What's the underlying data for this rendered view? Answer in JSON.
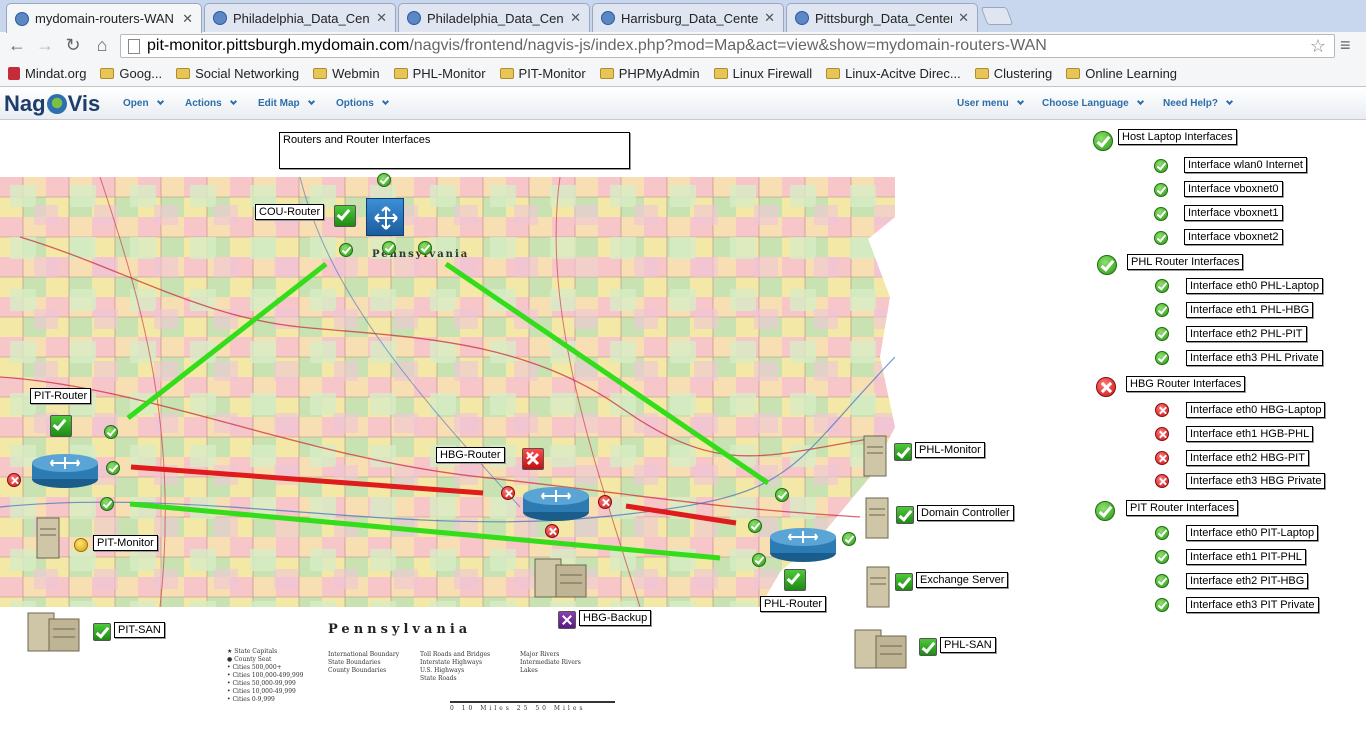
{
  "browser": {
    "tabs": [
      {
        "title": "mydomain-routers-WAN",
        "active": true
      },
      {
        "title": "Philadelphia_Data_Center",
        "active": false
      },
      {
        "title": "Philadelphia_Data_Center",
        "active": false
      },
      {
        "title": "Harrisburg_Data_Center (",
        "active": false
      },
      {
        "title": "Pittsburgh_Data_Center_",
        "active": false
      }
    ],
    "url_host": "pit-monitor.pittsburgh.mydomain.com",
    "url_path": "/nagvis/frontend/nagvis-js/index.php?mod=Map&act=view&show=mydomain-routers-WAN",
    "bookmarks": [
      {
        "label": "Mindat.org",
        "icon": "mindat-icon"
      },
      {
        "label": "Goog...",
        "icon": "folder-icon"
      },
      {
        "label": "Social Networking",
        "icon": "folder-icon"
      },
      {
        "label": "Webmin",
        "icon": "folder-icon"
      },
      {
        "label": "PHL-Monitor",
        "icon": "folder-icon"
      },
      {
        "label": "PIT-Monitor",
        "icon": "folder-icon"
      },
      {
        "label": "PHPMyAdmin",
        "icon": "folder-icon"
      },
      {
        "label": "Linux Firewall",
        "icon": "folder-icon"
      },
      {
        "label": "Linux-Acitve Direc...",
        "icon": "folder-icon"
      },
      {
        "label": "Clustering",
        "icon": "folder-icon"
      },
      {
        "label": "Online Learning",
        "icon": "folder-icon"
      }
    ]
  },
  "nagvis": {
    "logo_a": "Nag",
    "logo_b": "Vis",
    "menu_left": [
      "Open",
      "Actions",
      "Edit Map",
      "Options"
    ],
    "menu_right": [
      "User menu",
      "Choose Language",
      "Need Help?"
    ]
  },
  "map": {
    "title": "Routers and Router Interfaces",
    "state_label": "Pennsylvania",
    "map_caption": "Pennsylvania",
    "nodes": {
      "cou_router": "COU-Router",
      "pit_router": "PIT-Router",
      "hbg_router": "HBG-Router",
      "phl_router": "PHL-Router",
      "pit_monitor": "PIT-Monitor",
      "pit_san": "PIT-SAN",
      "hbg_backup": "HBG-Backup",
      "phl_monitor": "PHL-Monitor",
      "domain_controller": "Domain Controller",
      "exchange_server": "Exchange Server",
      "phl_san": "PHL-SAN"
    },
    "legend": {
      "col1": [
        "★ State Capitals",
        "● County Seat",
        "• Cities 500,000+",
        "• Cities 100,000-499,999",
        "• Cities 50,000-99,999",
        "• Cities 10,000-49,999",
        "• Cities 0-9,999"
      ],
      "col2": [
        "International Boundary",
        "State Boundaries",
        "County Boundaries"
      ],
      "col3": [
        "Toll Roads and Bridges",
        "Interstate Highways",
        "U.S. Highways",
        "State Roads"
      ],
      "col4": [
        "Major Rivers",
        "Intermediate Rivers",
        "Lakes"
      ]
    },
    "scale": "0 10 Miles 25 50 Miles",
    "status_colors": {
      "ok": "#2c9a18",
      "critical": "#c81313",
      "warning": "#d9a000",
      "unknown": "#5b1b80"
    }
  },
  "groups": [
    {
      "label": "Host Laptop Interfaces",
      "status": "ok",
      "items": [
        "Interface wlan0 Internet",
        "Interface vboxnet0",
        "Interface vboxnet1",
        "Interface vboxnet2"
      ]
    },
    {
      "label": "PHL Router Interfaces",
      "status": "ok",
      "items": [
        "Interface eth0 PHL-Laptop",
        "Interface eth1 PHL-HBG",
        "Interface eth2 PHL-PIT",
        "Interface eth3 PHL Private"
      ]
    },
    {
      "label": "HBG Router Interfaces",
      "status": "critical",
      "items": [
        "Interface eth0 HBG-Laptop",
        "Interface eth1 HGB-PHL",
        "Interface eth2 HBG-PIT",
        "Interface eth3 HBG Private"
      ]
    },
    {
      "label": "PIT Router Interfaces",
      "status": "ok",
      "items": [
        "Interface eth0 PIT-Laptop",
        "Interface eth1 PIT-PHL",
        "Interface eth2 PIT-HBG",
        "Interface eth3 PIT Private"
      ]
    }
  ]
}
